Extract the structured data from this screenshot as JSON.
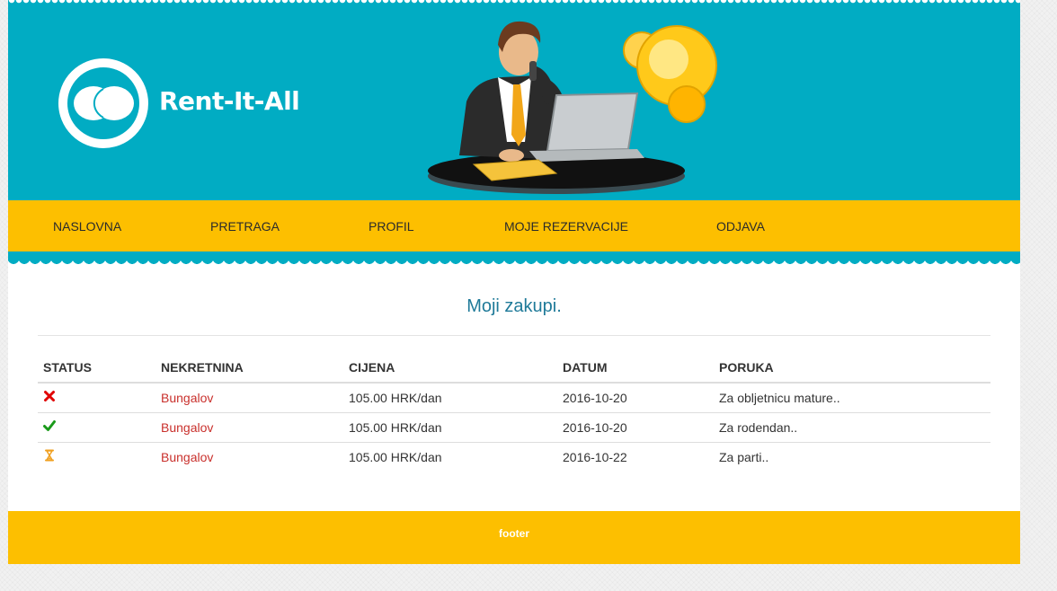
{
  "brand": {
    "name": "Rent-It-All"
  },
  "nav": {
    "items": [
      {
        "label": "NASLOVNA"
      },
      {
        "label": "PRETRAGA"
      },
      {
        "label": "PROFIL"
      },
      {
        "label": "MOJE REZERVACIJE"
      },
      {
        "label": "ODJAVA"
      }
    ]
  },
  "main": {
    "title": "Moji zakupi.",
    "table": {
      "columns": [
        "STATUS",
        "NEKRETNINA",
        "CIJENA",
        "DATUM",
        "PORUKA"
      ],
      "rows": [
        {
          "status": "rejected-icon",
          "property": "Bungalov",
          "price": "105.00 HRK/dan",
          "date": "2016-10-20",
          "message": "Za obljetnicu mature.."
        },
        {
          "status": "approved-icon",
          "property": "Bungalov",
          "price": "105.00 HRK/dan",
          "date": "2016-10-20",
          "message": "Za rodendan.."
        },
        {
          "status": "pending-icon",
          "property": "Bungalov",
          "price": "105.00 HRK/dan",
          "date": "2016-10-22",
          "message": "Za parti.."
        }
      ]
    }
  },
  "footer": {
    "text": "footer"
  },
  "colors": {
    "header_bg": "#01acc3",
    "nav_bg": "#fdbf00",
    "title": "#1f7a99",
    "link": "#c9302c",
    "rejected": "#e00000",
    "approved": "#1a9a1a",
    "pending": "#f0a020"
  }
}
